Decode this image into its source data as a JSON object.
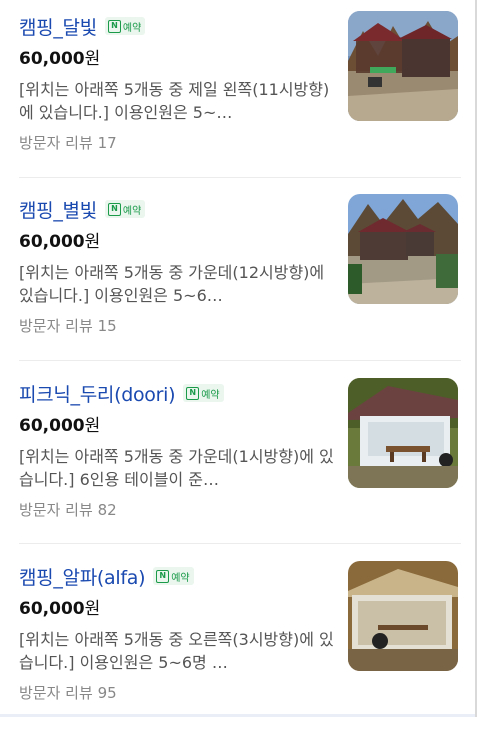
{
  "items": [
    {
      "name": "캠핑_달빛",
      "badge": "예약",
      "price": "60,000",
      "currency": "원",
      "description": "[위치는 아래쪽 5개동 중 제일 왼쪽(11시방향)에 있습니다.] 이용인원은 5~…",
      "review_label": "방문자 리뷰",
      "review_count": "17"
    },
    {
      "name": "캠핑_별빛",
      "badge": "예약",
      "price": "60,000",
      "currency": "원",
      "description": "[위치는 아래쪽 5개동 중 가운데(12시방향)에 있습니다.] 이용인원은 5~6…",
      "review_label": "방문자 리뷰",
      "review_count": "15"
    },
    {
      "name": "피크닉_두리(doori)",
      "badge": "예약",
      "price": "60,000",
      "currency": "원",
      "description": "[위치는 아래쪽 5개동 중 가운데(1시방향)에 있습니다.] 6인용 테이블이 준…",
      "review_label": "방문자 리뷰",
      "review_count": "82"
    },
    {
      "name": "캠핑_알파(alfa)",
      "badge": "예약",
      "price": "60,000",
      "currency": "원",
      "description": "[위치는 아래쪽 5개동 중 오른쪽(3시방향)에 있습니다.] 이용인원은 5~6명 …",
      "review_label": "방문자 리뷰",
      "review_count": "95"
    }
  ],
  "colors": {
    "title": "#1a49b0",
    "badge_green": "#1b9b4a",
    "muted": "#888888"
  }
}
